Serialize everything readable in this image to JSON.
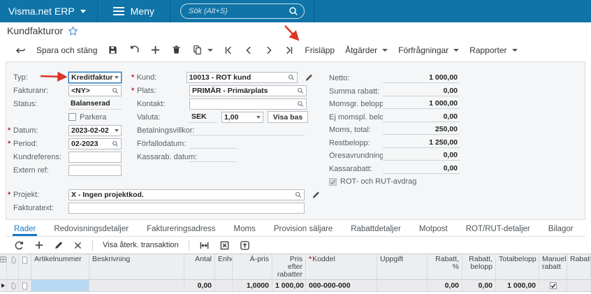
{
  "colors": {
    "topbar_blue": "#0f74a8",
    "accent_blue": "#1779c4",
    "annotation_red": "#dd3526",
    "selected_cell_blue": "#b9d8f2",
    "star_blue": "#4a90d9"
  },
  "icons": {
    "menu-icon": "hamburger",
    "search-icon": "magnifier",
    "favorite-icon": "star-outline",
    "back-icon": "arrow-left-hook",
    "save-icon": "floppy-disk",
    "undo-icon": "curved-arrow",
    "add-icon": "plus",
    "delete-icon": "trash",
    "copy-icon": "two-documents",
    "first-icon": "bar-chevron-left",
    "prev-icon": "chevron-left",
    "next-icon": "chevron-right",
    "last-icon": "chevron-right-bar",
    "refresh-icon": "circular-arrow",
    "edit-icon": "pencil",
    "remove-icon": "x",
    "fit-width-icon": "double-arrow-bars",
    "excel-icon": "x-in-box",
    "export-icon": "arrow-up-box",
    "lookup-icon": "magnifier",
    "attachment-icon": "paperclip",
    "note-icon": "document",
    "column-config-icon": "grid"
  },
  "topbar": {
    "brand": "Visma.net ERP",
    "menu_label": "Meny",
    "search_placeholder": "Sök (Alt+S)"
  },
  "page": {
    "title": "Kundfakturor"
  },
  "toolbar": {
    "save_and_close": "Spara och stäng",
    "release": "Frisläpp",
    "actions": "Åtgärder",
    "inquiries": "Förfrågningar",
    "reports": "Rapporter"
  },
  "form": {
    "typ": {
      "label": "Typ:",
      "value": "Kreditfaktura"
    },
    "fakturanr": {
      "label": "Fakturanr:",
      "value": "<NY>"
    },
    "status": {
      "label": "Status:",
      "value": "Balanserad"
    },
    "parkera": {
      "label": "Parkera",
      "checked": false
    },
    "datum": {
      "label": "Datum:",
      "value": "2023-02-02"
    },
    "period": {
      "label": "Period:",
      "value": "02-2023"
    },
    "kundreferens": {
      "label": "Kundreferens:",
      "value": ""
    },
    "extern_ref": {
      "label": "Extern ref:",
      "value": ""
    },
    "kund": {
      "label": "Kund:",
      "value": "10013 - ROT kund"
    },
    "plats": {
      "label": "Plats:",
      "value": "PRIMÄR - Primärplats"
    },
    "kontakt": {
      "label": "Kontakt:",
      "value": ""
    },
    "valuta": {
      "label": "Valuta:",
      "code": "SEK",
      "rate": "1,00",
      "visa_bas": "Visa bas"
    },
    "betalningsvillkor": {
      "label": "Betalningsvillkor:",
      "value": ""
    },
    "forfallodatum": {
      "label": "Förfallodatum:",
      "value": ""
    },
    "kassarab_datum": {
      "label": "Kassarab. datum:",
      "value": ""
    },
    "projekt": {
      "label": "Projekt:",
      "value": "X - Ingen projektkod."
    },
    "fakturatext": {
      "label": "Fakturatext:",
      "value": ""
    },
    "rot_rut": {
      "label": "ROT- och RUT-avdrag",
      "checked": true
    },
    "totals": [
      {
        "label": "Netto:",
        "value": "1 000,00"
      },
      {
        "label": "Summa rabatt:",
        "value": "0,00"
      },
      {
        "label": "Momsgr. belopp:",
        "value": "1 000,00"
      },
      {
        "label": "Ej momspl. belo...",
        "value": "0,00"
      },
      {
        "label": "Moms, total:",
        "value": "250,00"
      },
      {
        "label": "Restbelopp:",
        "value": "1 250,00"
      },
      {
        "label": "Öresavrundning:",
        "value": "0,00"
      },
      {
        "label": "Kassarabatt:",
        "value": "0,00"
      }
    ]
  },
  "tabs": [
    "Rader",
    "Redovisningsdetaljer",
    "Faktureringsadress",
    "Moms",
    "Provision säljare",
    "Rabattdetaljer",
    "Motpost",
    "ROT/RUT-detaljer",
    "Bilagor"
  ],
  "grid_toolbar": {
    "visa_aterk": "Visa återk. transaktion"
  },
  "table": {
    "headers": {
      "artikelnummer": "Artikelnummer",
      "beskrivning": "Beskrivning",
      "antal": "Antal",
      "enhet": "Enhet",
      "a_pris": "Á-pris",
      "pris_efter_rabatter": "Pris efter rabatter",
      "koddel": "Koddel",
      "uppgift": "Uppgift",
      "rabatt_procent": "Rabatt, %",
      "rabatt_belopp": "Rabatt, belopp",
      "totalbelopp": "Totalbelopp",
      "manuell_rabatt": "Manuell rabatt",
      "rabatt_trunc": "Rabatt,"
    },
    "row": {
      "antal": "0,00",
      "a_pris": "1,0000",
      "pris_efter_rabatter": "1 000,00",
      "koddel": "000-000-000",
      "uppgift": "",
      "rabatt_procent": "0,00",
      "rabatt_belopp": "0,00",
      "totalbelopp": "1 000,00",
      "manuell_rabatt_checked": true
    }
  }
}
